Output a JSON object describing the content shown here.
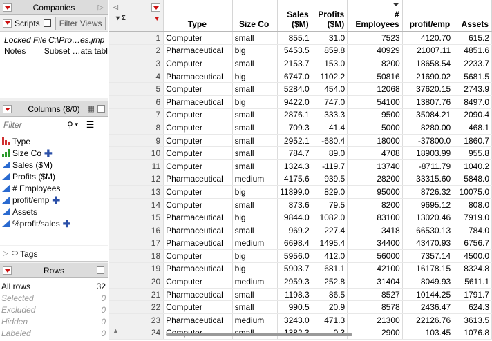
{
  "companies_panel": {
    "title": "Companies",
    "scripts_label": "Scripts",
    "filter_views_label": "Filter Views",
    "properties": [
      {
        "key": "Locked File",
        "value": "C:\\Pro…es.jmp",
        "italic": true
      },
      {
        "key": "Notes",
        "value": "Subset …ata table.",
        "italic": false
      }
    ]
  },
  "columns_panel": {
    "title": "Columns (8/0)",
    "filter_placeholder": "Filter",
    "columns": [
      {
        "name": "Type",
        "icon": "nominal-bar-icon",
        "color": "#d03030",
        "formula": false
      },
      {
        "name": "Size Co",
        "icon": "ordinal-bar-icon",
        "color": "#2a9a2a",
        "formula": true
      },
      {
        "name": "Sales ($M)",
        "icon": "continuous-ramp-icon",
        "color": "#2a6ad0",
        "formula": false
      },
      {
        "name": "Profits ($M)",
        "icon": "continuous-ramp-icon",
        "color": "#2a6ad0",
        "formula": false
      },
      {
        "name": "# Employees",
        "icon": "continuous-ramp-icon",
        "color": "#2a6ad0",
        "formula": false
      },
      {
        "name": "profit/emp",
        "icon": "continuous-ramp-icon",
        "color": "#2a6ad0",
        "formula": true
      },
      {
        "name": "Assets",
        "icon": "continuous-ramp-icon",
        "color": "#2a6ad0",
        "formula": false
      },
      {
        "name": "%profit/sales",
        "icon": "continuous-ramp-icon",
        "color": "#2a6ad0",
        "formula": true
      }
    ]
  },
  "tags_label": "Tags",
  "rows_panel": {
    "title": "Rows",
    "items": [
      {
        "label": "All rows",
        "value": "32",
        "dim": false
      },
      {
        "label": "Selected",
        "value": "0",
        "dim": true
      },
      {
        "label": "Excluded",
        "value": "0",
        "dim": true
      },
      {
        "label": "Hidden",
        "value": "0",
        "dim": true
      },
      {
        "label": "Labeled",
        "value": "0",
        "dim": true
      }
    ]
  },
  "grid": {
    "headers": [
      "Type",
      "Size Co",
      "Sales\n($M)",
      "Profits\n($M)",
      "# Employees",
      "profit/emp",
      "Assets"
    ],
    "rows": [
      [
        "1",
        "Computer",
        "small",
        "855.1",
        "31.0",
        "7523",
        "4120.70",
        "615.2"
      ],
      [
        "2",
        "Pharmaceutical",
        "big",
        "5453.5",
        "859.8",
        "40929",
        "21007.11",
        "4851.6"
      ],
      [
        "3",
        "Computer",
        "small",
        "2153.7",
        "153.0",
        "8200",
        "18658.54",
        "2233.7"
      ],
      [
        "4",
        "Pharmaceutical",
        "big",
        "6747.0",
        "1102.2",
        "50816",
        "21690.02",
        "5681.5"
      ],
      [
        "5",
        "Computer",
        "small",
        "5284.0",
        "454.0",
        "12068",
        "37620.15",
        "2743.9"
      ],
      [
        "6",
        "Pharmaceutical",
        "big",
        "9422.0",
        "747.0",
        "54100",
        "13807.76",
        "8497.0"
      ],
      [
        "7",
        "Computer",
        "small",
        "2876.1",
        "333.3",
        "9500",
        "35084.21",
        "2090.4"
      ],
      [
        "8",
        "Computer",
        "small",
        "709.3",
        "41.4",
        "5000",
        "8280.00",
        "468.1"
      ],
      [
        "9",
        "Computer",
        "small",
        "2952.1",
        "-680.4",
        "18000",
        "-37800.0",
        "1860.7"
      ],
      [
        "10",
        "Computer",
        "small",
        "784.7",
        "89.0",
        "4708",
        "18903.99",
        "955.8"
      ],
      [
        "11",
        "Computer",
        "small",
        "1324.3",
        "-119.7",
        "13740",
        "-8711.79",
        "1040.2"
      ],
      [
        "12",
        "Pharmaceutical",
        "medium",
        "4175.6",
        "939.5",
        "28200",
        "33315.60",
        "5848.0"
      ],
      [
        "13",
        "Computer",
        "big",
        "11899.0",
        "829.0",
        "95000",
        "8726.32",
        "10075.0"
      ],
      [
        "14",
        "Computer",
        "small",
        "873.6",
        "79.5",
        "8200",
        "9695.12",
        "808.0"
      ],
      [
        "15",
        "Pharmaceutical",
        "big",
        "9844.0",
        "1082.0",
        "83100",
        "13020.46",
        "7919.0"
      ],
      [
        "16",
        "Pharmaceutical",
        "small",
        "969.2",
        "227.4",
        "3418",
        "66530.13",
        "784.0"
      ],
      [
        "17",
        "Pharmaceutical",
        "medium",
        "6698.4",
        "1495.4",
        "34400",
        "43470.93",
        "6756.7"
      ],
      [
        "18",
        "Computer",
        "big",
        "5956.0",
        "412.0",
        "56000",
        "7357.14",
        "4500.0"
      ],
      [
        "19",
        "Pharmaceutical",
        "big",
        "5903.7",
        "681.1",
        "42100",
        "16178.15",
        "8324.8"
      ],
      [
        "20",
        "Computer",
        "medium",
        "2959.3",
        "252.8",
        "31404",
        "8049.93",
        "5611.1"
      ],
      [
        "21",
        "Pharmaceutical",
        "small",
        "1198.3",
        "86.5",
        "8527",
        "10144.25",
        "1791.7"
      ],
      [
        "22",
        "Computer",
        "small",
        "990.5",
        "20.9",
        "8578",
        "2436.47",
        "624.3"
      ],
      [
        "23",
        "Pharmaceutical",
        "medium",
        "3243.0",
        "471.3",
        "21300",
        "22126.76",
        "3613.5"
      ],
      [
        "24",
        "Computer",
        "small",
        "1382.3",
        "0.3",
        "2900",
        "103.45",
        "1076.8"
      ]
    ]
  },
  "colors": {
    "accent_red": "#cc1111",
    "continuous_blue": "#2a6ad0",
    "formula_plus": "#2a4fa8"
  }
}
